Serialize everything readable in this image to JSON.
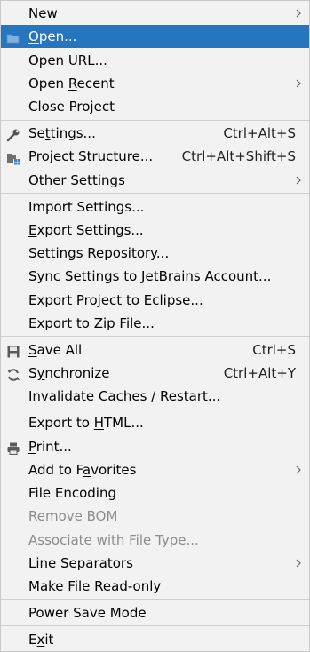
{
  "menu": {
    "new": {
      "label": "New"
    },
    "open": {
      "label_pre": "",
      "label_mn": "O",
      "label_post": "pen..."
    },
    "open_url": {
      "label": "Open URL..."
    },
    "open_recent": {
      "label_pre": "Open ",
      "label_mn": "R",
      "label_post": "ecent"
    },
    "close_project": {
      "label": "Close Project"
    },
    "settings": {
      "label_pre": "Se",
      "label_mn": "t",
      "label_post": "tings...",
      "shortcut": "Ctrl+Alt+S"
    },
    "project_structure": {
      "label": "Project Structure...",
      "shortcut": "Ctrl+Alt+Shift+S"
    },
    "other_settings": {
      "label": "Other Settings"
    },
    "import_settings": {
      "label": "Import Settings..."
    },
    "export_settings": {
      "label_pre": "",
      "label_mn": "E",
      "label_post": "xport Settings..."
    },
    "settings_repository": {
      "label": "Settings Repository..."
    },
    "sync_settings": {
      "label": "Sync Settings to JetBrains Account..."
    },
    "export_eclipse": {
      "label": "Export Project to Eclipse..."
    },
    "export_zip": {
      "label": "Export to Zip File..."
    },
    "save_all": {
      "label_pre": "",
      "label_mn": "S",
      "label_post": "ave All",
      "shortcut": "Ctrl+S"
    },
    "synchronize": {
      "label_pre": "S",
      "label_mn": "y",
      "label_post": "nchronize",
      "shortcut": "Ctrl+Alt+Y"
    },
    "invalidate_caches": {
      "label": "Invalidate Caches / Restart..."
    },
    "export_html": {
      "label_pre": "Export to ",
      "label_mn": "H",
      "label_post": "TML..."
    },
    "print": {
      "label_pre": "",
      "label_mn": "P",
      "label_post": "rint..."
    },
    "add_favorites": {
      "label_pre": "Add to F",
      "label_mn": "a",
      "label_post": "vorites"
    },
    "file_encoding": {
      "label": "File Encoding"
    },
    "remove_bom": {
      "label": "Remove BOM"
    },
    "associate_file_type": {
      "label": "Associate with File Type..."
    },
    "line_separators": {
      "label": "Line Separators"
    },
    "make_readonly": {
      "label": "Make File Read-only"
    },
    "power_save": {
      "label": "Power Save Mode"
    },
    "exit": {
      "label_pre": "E",
      "label_mn": "x",
      "label_post": "it"
    }
  },
  "colors": {
    "highlight": "#2675bf",
    "background": "#f2f2f2",
    "disabled_text": "#8c8c8c"
  }
}
